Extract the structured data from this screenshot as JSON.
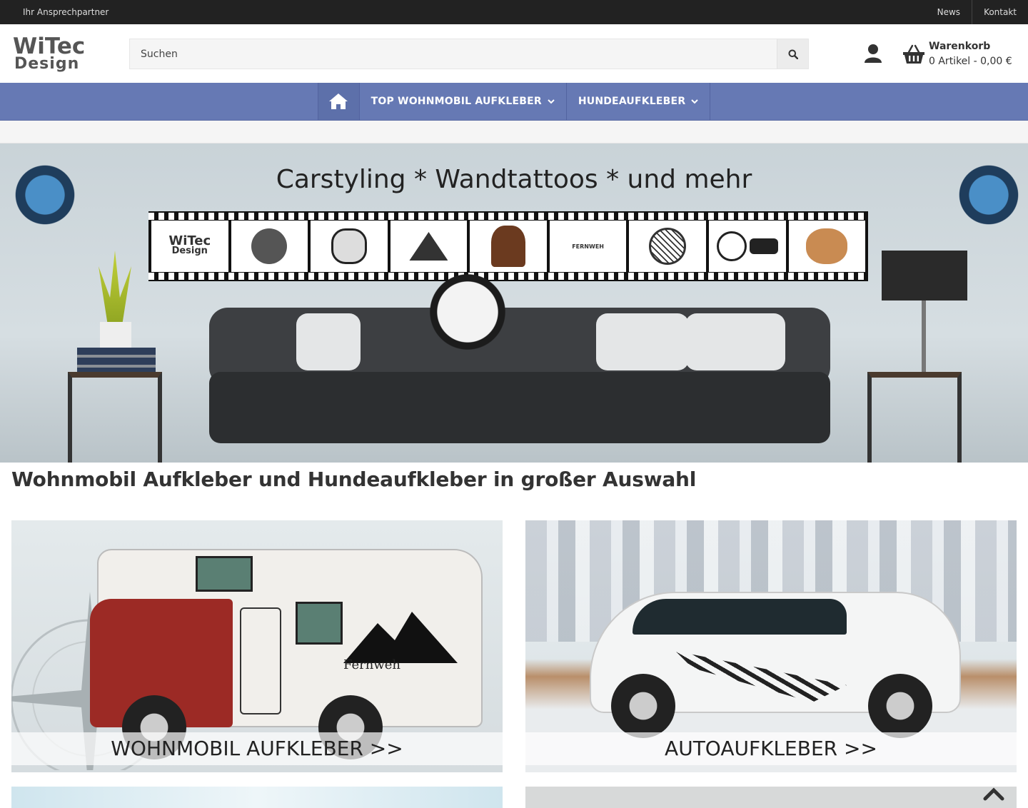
{
  "topbar": {
    "contact_person": "Ihr Ansprechpartner",
    "links": [
      "News",
      "Kontakt"
    ]
  },
  "header": {
    "logo_line1": "WiTec",
    "logo_line2": "Design",
    "search_placeholder": "Suchen",
    "cart_title": "Warenkorb",
    "cart_summary": "0 Artikel - 0,00 €"
  },
  "nav": {
    "items": [
      "TOP WOHNMOBIL AUFKLEBER",
      "HUNDEAUFKLEBER"
    ]
  },
  "hero": {
    "title": "Carstyling * Wandtattoos * und mehr",
    "film_logo_line1": "WiTec",
    "film_logo_line2": "Design",
    "film_label": "FERNWEH"
  },
  "main": {
    "headline": "Wohnmobil Aufkleber und Hundeaufkleber in großer Auswahl",
    "tiles": [
      {
        "caption": "WOHNMOBIL AUFKLEBER >>",
        "decal": "Fernweh"
      },
      {
        "caption": "AUTOAUFKLEBER >>"
      }
    ]
  },
  "colors": {
    "topbar": "#222222",
    "nav": "#6679b4",
    "accent": "#5d70aa"
  },
  "icons": [
    "search-icon",
    "user-icon",
    "basket-icon",
    "home-icon",
    "chevron-down-icon",
    "chevron-up-icon"
  ]
}
